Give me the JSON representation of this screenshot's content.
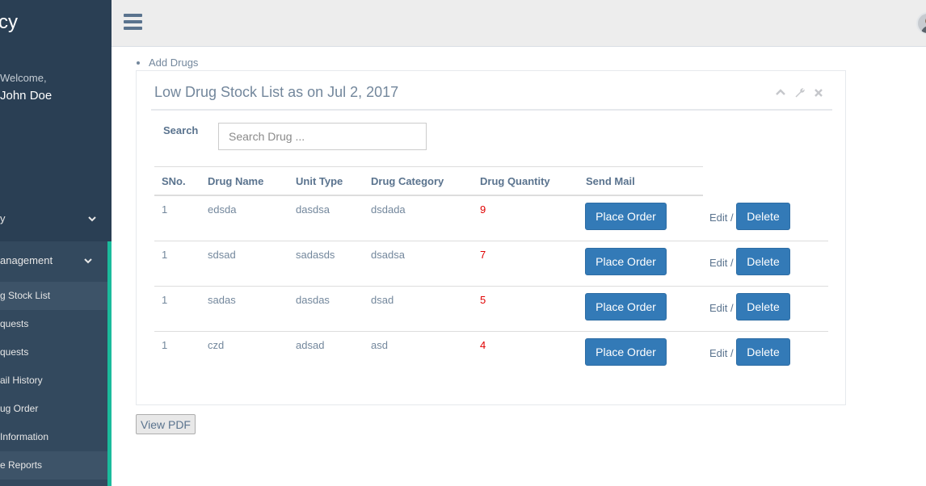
{
  "sidebar": {
    "brand": "cy",
    "welcome": "Welcome,",
    "username": "John Doe",
    "menu": [
      {
        "label": "y"
      },
      {
        "label": "anagement"
      }
    ],
    "submenu": [
      {
        "label": "g Stock List",
        "active": true
      },
      {
        "label": "quests"
      },
      {
        "label": "quests"
      },
      {
        "label": "ail History"
      },
      {
        "label": "ug Order"
      },
      {
        "label": " Information"
      },
      {
        "label": "e Reports",
        "active": true
      }
    ],
    "accent_color": "#1abb9c"
  },
  "topbar": {
    "menu_icon": "hamburger-icon",
    "avatar_icon": "user-avatar"
  },
  "breadcrumb": {
    "items": [
      "Add Drugs"
    ]
  },
  "panel": {
    "title": "Low Drug Stock List as on Jul 2, 2017",
    "tools": [
      "chevron-up-icon",
      "wrench-icon",
      "close-icon"
    ],
    "search": {
      "label": "Search",
      "placeholder": "Search Drug ..."
    },
    "table": {
      "headers": [
        "SNo.",
        "Drug Name",
        "Unit Type",
        "Drug Category",
        "Drug Quantity",
        "Send Mail"
      ],
      "rows": [
        {
          "sno": "1",
          "name": "edsda",
          "unit": "dasdsa",
          "category": "dsdada",
          "qty": "9",
          "order_label": "Place Order",
          "edit_label": "Edit /",
          "delete_label": "Delete"
        },
        {
          "sno": "1",
          "name": "sdsad",
          "unit": "sadasds",
          "category": "dsadsa",
          "qty": "7",
          "order_label": "Place Order",
          "edit_label": "Edit /",
          "delete_label": "Delete"
        },
        {
          "sno": "1",
          "name": "sadas",
          "unit": "dasdas",
          "category": "dsad",
          "qty": "5",
          "order_label": "Place Order",
          "edit_label": "Edit /",
          "delete_label": "Delete"
        },
        {
          "sno": "1",
          "name": "czd",
          "unit": "adsad",
          "category": "asd",
          "qty": "4",
          "order_label": "Place Order",
          "edit_label": "Edit /",
          "delete_label": "Delete"
        }
      ]
    }
  },
  "actions": {
    "view_pdf": "View PDF"
  },
  "colors": {
    "primary": "#337ab7",
    "low_qty": "#e00000",
    "sidebar_bg": "#2a3f54"
  }
}
